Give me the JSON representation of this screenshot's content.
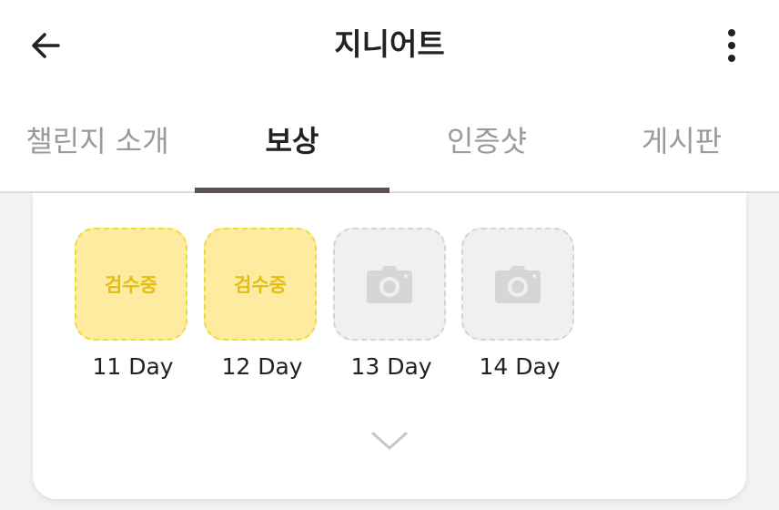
{
  "header": {
    "title": "지니어트",
    "back_icon": "arrow-left-icon",
    "more_icon": "more-vertical-icon"
  },
  "tabs": [
    {
      "label": "챌린지 소개",
      "active": false
    },
    {
      "label": "보상",
      "active": true
    },
    {
      "label": "인증샷",
      "active": false
    },
    {
      "label": "게시판",
      "active": false
    }
  ],
  "days": [
    {
      "label": "11 Day",
      "status": "pending",
      "badge": "검수중"
    },
    {
      "label": "12 Day",
      "status": "pending",
      "badge": "검수중"
    },
    {
      "label": "13 Day",
      "status": "empty",
      "icon": "camera-icon"
    },
    {
      "label": "14 Day",
      "status": "empty",
      "icon": "camera-icon"
    }
  ],
  "expand_icon": "chevron-down-icon",
  "colors": {
    "tab_indicator": "#5d4f54",
    "pending_fill": "#fdeba0",
    "pending_border": "#f2d93b",
    "pending_text": "#e3bd12",
    "empty_fill": "#f0f0f0",
    "empty_border": "#d4d4d4",
    "camera_icon": "#d6d6d6"
  }
}
